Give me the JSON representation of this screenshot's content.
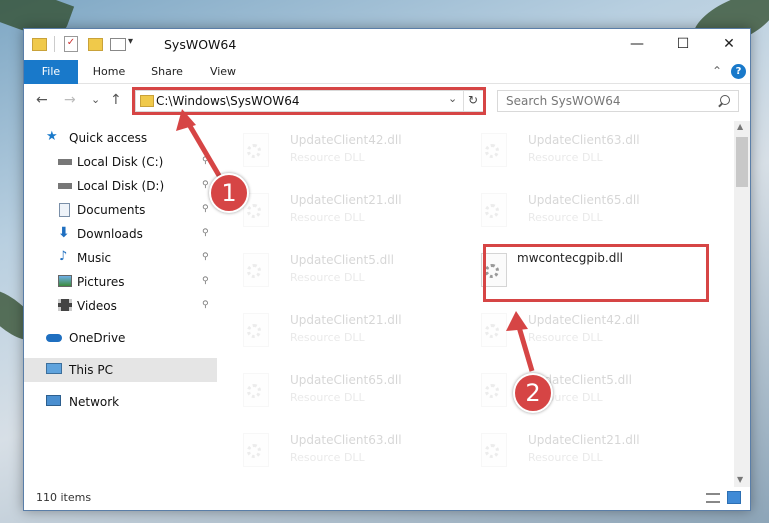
{
  "window": {
    "title": "SysWOW64",
    "minimize_glyph": "—",
    "maximize_glyph": "☐",
    "close_glyph": "✕"
  },
  "ribbon": {
    "tabs": [
      "File",
      "Home",
      "Share",
      "View"
    ],
    "collapse_glyph": "⌃",
    "help_glyph": "?"
  },
  "navigation": {
    "back_glyph": "←",
    "forward_glyph": "→",
    "recent_glyph": "⌄",
    "up_glyph": "↑",
    "address": "C:\\Windows\\SysWOW64",
    "address_dropdown_glyph": "⌄",
    "refresh_glyph": "↻",
    "search_placeholder": "Search SysWOW64"
  },
  "sidebar": {
    "items": [
      {
        "label": "Quick access",
        "icon": "star-icon"
      },
      {
        "label": "Local Disk (C:)",
        "icon": "drive-icon"
      },
      {
        "label": "Local Disk (D:)",
        "icon": "drive-icon"
      },
      {
        "label": "Documents",
        "icon": "documents-icon"
      },
      {
        "label": "Downloads",
        "icon": "downloads-icon"
      },
      {
        "label": "Music",
        "icon": "music-icon"
      },
      {
        "label": "Pictures",
        "icon": "pictures-icon"
      },
      {
        "label": "Videos",
        "icon": "videos-icon"
      },
      {
        "label": "OneDrive",
        "icon": "cloud-icon"
      },
      {
        "label": "This PC",
        "icon": "computer-icon"
      },
      {
        "label": "Network",
        "icon": "network-icon"
      }
    ],
    "pin_glyph": "📌"
  },
  "files": {
    "rows": [
      [
        {
          "name": "UpdateClient42.dll",
          "type": "Resource DLL"
        },
        {
          "name": "UpdateClient63.dll",
          "type": "Resource DLL"
        }
      ],
      [
        {
          "name": "UpdateClient21.dll",
          "type": "Resource DLL"
        },
        {
          "name": "UpdateClient65.dll",
          "type": "Resource DLL"
        }
      ],
      [
        {
          "name": "UpdateClient5.dll",
          "type": "Resource DLL"
        },
        {
          "name": "mwcontecgpib.dll",
          "type": ""
        }
      ],
      [
        {
          "name": "UpdateClient21.dll",
          "type": "Resource DLL"
        },
        {
          "name": "UpdateClient42.dll",
          "type": "Resource DLL"
        }
      ],
      [
        {
          "name": "UpdateClient65.dll",
          "type": "Resource DLL"
        },
        {
          "name": "UpdateClient5.dll",
          "type": "Resource DLL"
        }
      ],
      [
        {
          "name": "UpdateClient63.dll",
          "type": "Resource DLL"
        },
        {
          "name": "UpdateClient21.dll",
          "type": "Resource DLL"
        }
      ]
    ]
  },
  "status": {
    "item_count": "110 items"
  },
  "annotations": {
    "step1": "1",
    "step2": "2",
    "color": "#d64545"
  }
}
